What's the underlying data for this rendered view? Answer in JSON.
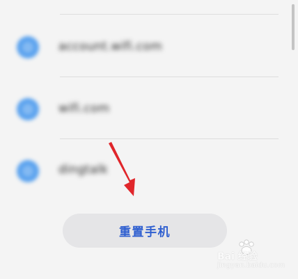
{
  "account_list": {
    "items": [
      {
        "label": "account.wifi.com"
      },
      {
        "label": "wifi.com"
      },
      {
        "label": "dingtalk"
      }
    ]
  },
  "reset_button": {
    "label": "重置手机"
  },
  "watermark": {
    "brand_text": "Bai 经验",
    "sub_text": "jingyan.baidu.com"
  },
  "colors": {
    "accent": "#2f5fd0",
    "arrow": "#e0262b",
    "icon": "#5aa2ee",
    "button_bg": "#e5e5e7",
    "background": "#f4f4f4"
  },
  "icons": {
    "account_icon": "circle-account-icon",
    "pointer": "red-arrow-icon",
    "watermark": "paw-icon"
  }
}
